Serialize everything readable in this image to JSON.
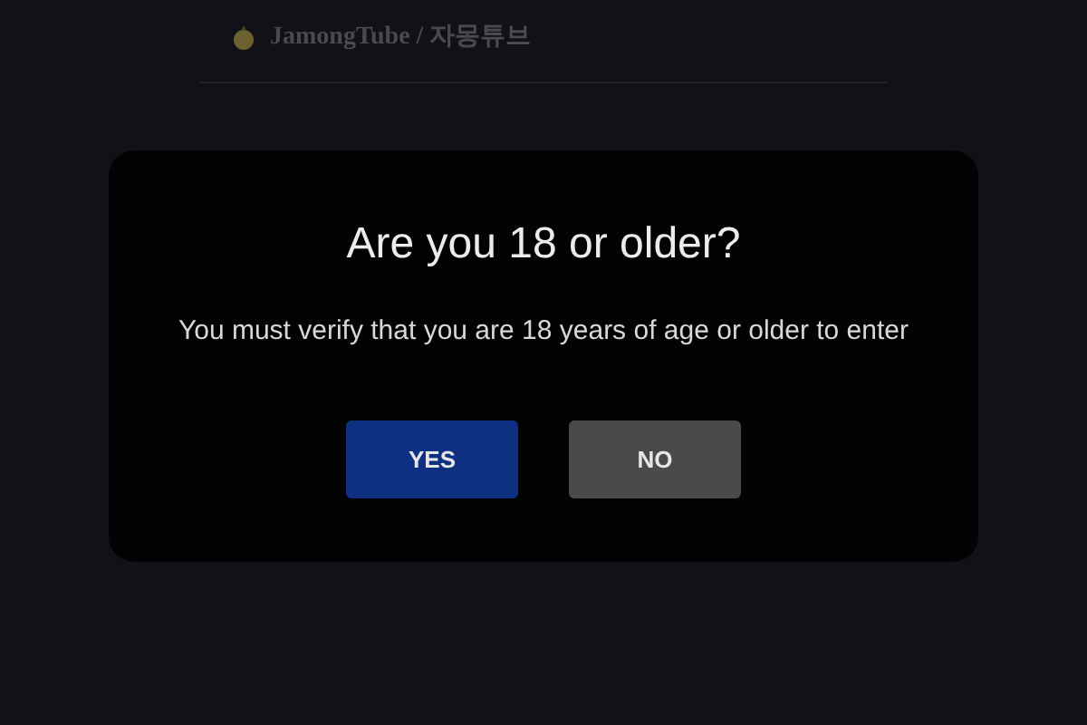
{
  "header": {
    "site_title": "JamongTube / 자몽튜브"
  },
  "dialog": {
    "title": "Are you 18 or older?",
    "message": "You must verify that you are 18 years of age or older to enter",
    "buttons": [
      {
        "label": "YES",
        "kind": "primary"
      },
      {
        "label": "NO",
        "kind": "secondary"
      }
    ]
  }
}
